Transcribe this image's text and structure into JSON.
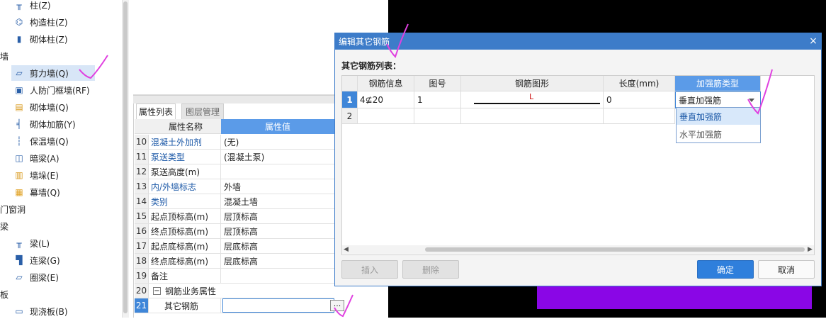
{
  "tree": {
    "items": [
      {
        "label": "柱(Z)",
        "icon": "column-icon"
      },
      {
        "label": "构造柱(Z)",
        "icon": "constructional-column-icon"
      },
      {
        "label": "砌体柱(Z)",
        "icon": "masonry-column-icon"
      },
      {
        "label": "墙",
        "icon": ""
      },
      {
        "label": "剪力墙(Q)",
        "icon": "shear-wall-icon"
      },
      {
        "label": "人防门框墙(RF)",
        "icon": "civil-defense-wall-icon"
      },
      {
        "label": "砌体墙(Q)",
        "icon": "masonry-wall-icon"
      },
      {
        "label": "砌体加筋(Y)",
        "icon": "masonry-reinforcement-icon"
      },
      {
        "label": "保温墙(Q)",
        "icon": "insulation-wall-icon"
      },
      {
        "label": "暗梁(A)",
        "icon": "hidden-beam-icon"
      },
      {
        "label": "墙垛(E)",
        "icon": "wall-pier-icon"
      },
      {
        "label": "幕墙(Q)",
        "icon": "curtain-wall-icon"
      },
      {
        "label": "门窗洞",
        "icon": ""
      },
      {
        "label": "梁",
        "icon": ""
      },
      {
        "label": "梁(L)",
        "icon": "beam-icon"
      },
      {
        "label": "连梁(G)",
        "icon": "coupling-beam-icon"
      },
      {
        "label": "圈梁(E)",
        "icon": "ring-beam-icon"
      },
      {
        "label": "板",
        "icon": ""
      },
      {
        "label": "现浇板(B)",
        "icon": "cast-slab-icon"
      }
    ]
  },
  "properties": {
    "tabs": [
      "属性列表",
      "图层管理"
    ],
    "col_name": "属性名称",
    "col_value": "属性值",
    "rows": [
      {
        "num": "10",
        "name": "混凝土外加剂",
        "value": "(无)"
      },
      {
        "num": "11",
        "name": "泵送类型",
        "value": "(混凝土泵)"
      },
      {
        "num": "12",
        "name": "泵送高度(m)",
        "value": ""
      },
      {
        "num": "13",
        "name": "内/外墙标志",
        "value": "外墙"
      },
      {
        "num": "14",
        "name": "类别",
        "value": "混凝土墙"
      },
      {
        "num": "15",
        "name": "起点顶标高(m)",
        "value": "层顶标高"
      },
      {
        "num": "16",
        "name": "终点顶标高(m)",
        "value": "层顶标高"
      },
      {
        "num": "17",
        "name": "起点底标高(m)",
        "value": "层底标高"
      },
      {
        "num": "18",
        "name": "终点底标高(m)",
        "value": "层底标高"
      },
      {
        "num": "19",
        "name": "备注",
        "value": ""
      },
      {
        "num": "20",
        "name": "钢筋业务属性",
        "value": ""
      },
      {
        "num": "21",
        "name": "其它钢筋",
        "value": ""
      }
    ],
    "ellipsis": "···",
    "collapse_symbol": "−"
  },
  "dialog": {
    "title": "编辑其它钢筋",
    "close": "×",
    "list_label": "其它钢筋列表：",
    "columns": [
      "钢筋信息",
      "图号",
      "钢筋图形",
      "长度(mm)",
      "加强筋类型"
    ],
    "rows": [
      {
        "num": "1",
        "info": "4⊈20",
        "fig_no": "1",
        "shape_label": "L",
        "length": "0",
        "type": "垂直加强筋"
      },
      {
        "num": "2",
        "info": "",
        "fig_no": "",
        "shape_label": "",
        "length": "",
        "type": ""
      }
    ],
    "dropdown_options": [
      "垂直加强筋",
      "水平加强筋"
    ],
    "buttons": {
      "insert": "插入",
      "delete": "删除",
      "ok": "确定",
      "cancel": "取消"
    }
  },
  "colors": {
    "accent": "#3d7cc9",
    "selected_header": "#5b9be8",
    "canvas": "#000000",
    "purple": "#8a06e6",
    "annotation": "#e040e0"
  }
}
